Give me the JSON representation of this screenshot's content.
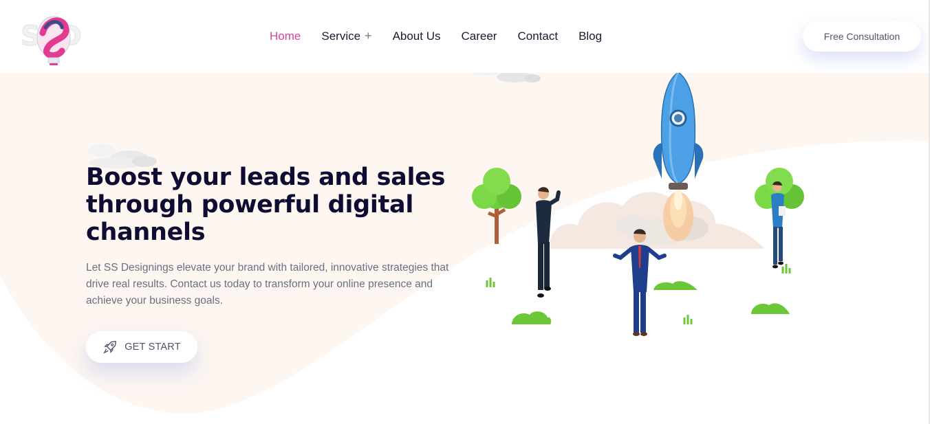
{
  "brand": {
    "logo_text": "SSD",
    "colors": {
      "accent": "#d8449b",
      "title": "#0f0c33",
      "body_text": "#6a6f80",
      "hero_bg": "#fdf6f1"
    }
  },
  "nav": {
    "items": [
      {
        "label": "Home",
        "active": true
      },
      {
        "label": "Service",
        "active": false,
        "has_submenu": true
      },
      {
        "label": "About Us",
        "active": false
      },
      {
        "label": "Career",
        "active": false
      },
      {
        "label": "Contact",
        "active": false
      },
      {
        "label": "Blog",
        "active": false
      }
    ],
    "submenu_icon": "+",
    "cta_label": "Free Consultation"
  },
  "hero": {
    "title_lines": [
      "Boost your leads and sales",
      "through powerful digital",
      "channels"
    ],
    "description": "Let SS Designings elevate your brand with tailored, innovative strategies that drive real results. Contact us today to transform your online presence and achieve your business goals.",
    "button_label": "GET START",
    "button_icon": "rocket-icon"
  }
}
